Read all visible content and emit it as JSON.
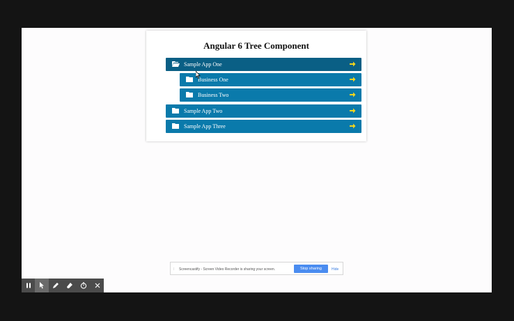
{
  "card": {
    "title": "Angular 6 Tree Component"
  },
  "tree": {
    "nodes": [
      {
        "label": "Sample App One",
        "expanded": true,
        "icon": "folder-open-icon"
      },
      {
        "label": "Business One",
        "icon": "folder-icon"
      },
      {
        "label": "Business Two",
        "icon": "folder-icon"
      },
      {
        "label": "Sample App Two",
        "icon": "folder-icon"
      },
      {
        "label": "Sample App Three",
        "icon": "folder-icon"
      }
    ],
    "node_color": "#0a7aab",
    "arrow_color": "#f3d51c"
  },
  "share_bar": {
    "message": "Screencastify - Screen Video Recorder is sharing your screen.",
    "stop_label": "Stop sharing",
    "hide_label": "Hide"
  },
  "toolbar": {
    "tools": [
      "pause-icon",
      "pointer-icon",
      "pen-icon",
      "eraser-icon",
      "timer-icon",
      "close-icon"
    ]
  }
}
